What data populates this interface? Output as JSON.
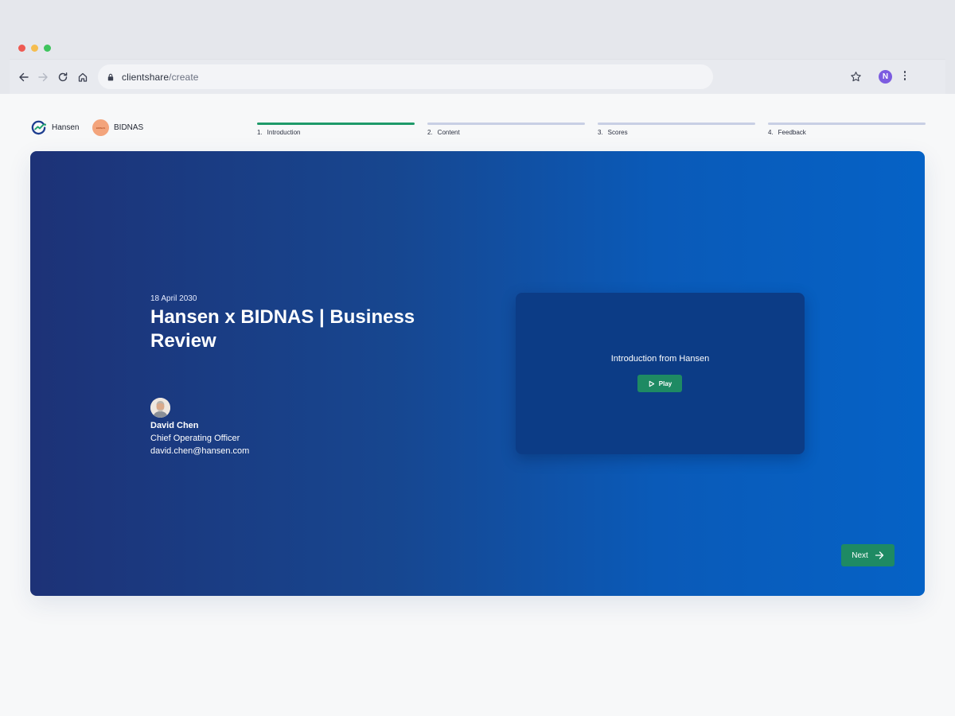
{
  "browser": {
    "url_host": "clientshare",
    "url_path": "/create",
    "profile_initial": "N"
  },
  "brands": {
    "company": "Hansen",
    "client": "BIDNAS",
    "client_logo_text": "BIDNAS"
  },
  "steps": [
    {
      "number": "1.",
      "label": "Introduction",
      "active": true
    },
    {
      "number": "2.",
      "label": "Content",
      "active": false
    },
    {
      "number": "3.",
      "label": "Scores",
      "active": false
    },
    {
      "number": "4.",
      "label": "Feedback",
      "active": false
    }
  ],
  "hero": {
    "date": "18 April 2030",
    "title": "Hansen x BIDNAS | Business Review",
    "person": {
      "name": "David Chen",
      "role": "Chief Operating Officer",
      "email": "david.chen@hansen.com"
    },
    "video": {
      "title": "Introduction from Hansen",
      "play_label": "Play"
    },
    "next_label": "Next"
  },
  "colors": {
    "accent_green": "#1e8a63",
    "step_active": "#1e9a69",
    "step_inactive": "#c8cfe4",
    "hero_start": "#1d3277",
    "hero_end": "#0562c6"
  },
  "icons": [
    "back-arrow-icon",
    "forward-arrow-icon",
    "reload-icon",
    "home-icon",
    "lock-icon",
    "star-icon",
    "menu-dots-icon",
    "hansen-logo-icon",
    "play-icon",
    "arrow-right-icon"
  ]
}
